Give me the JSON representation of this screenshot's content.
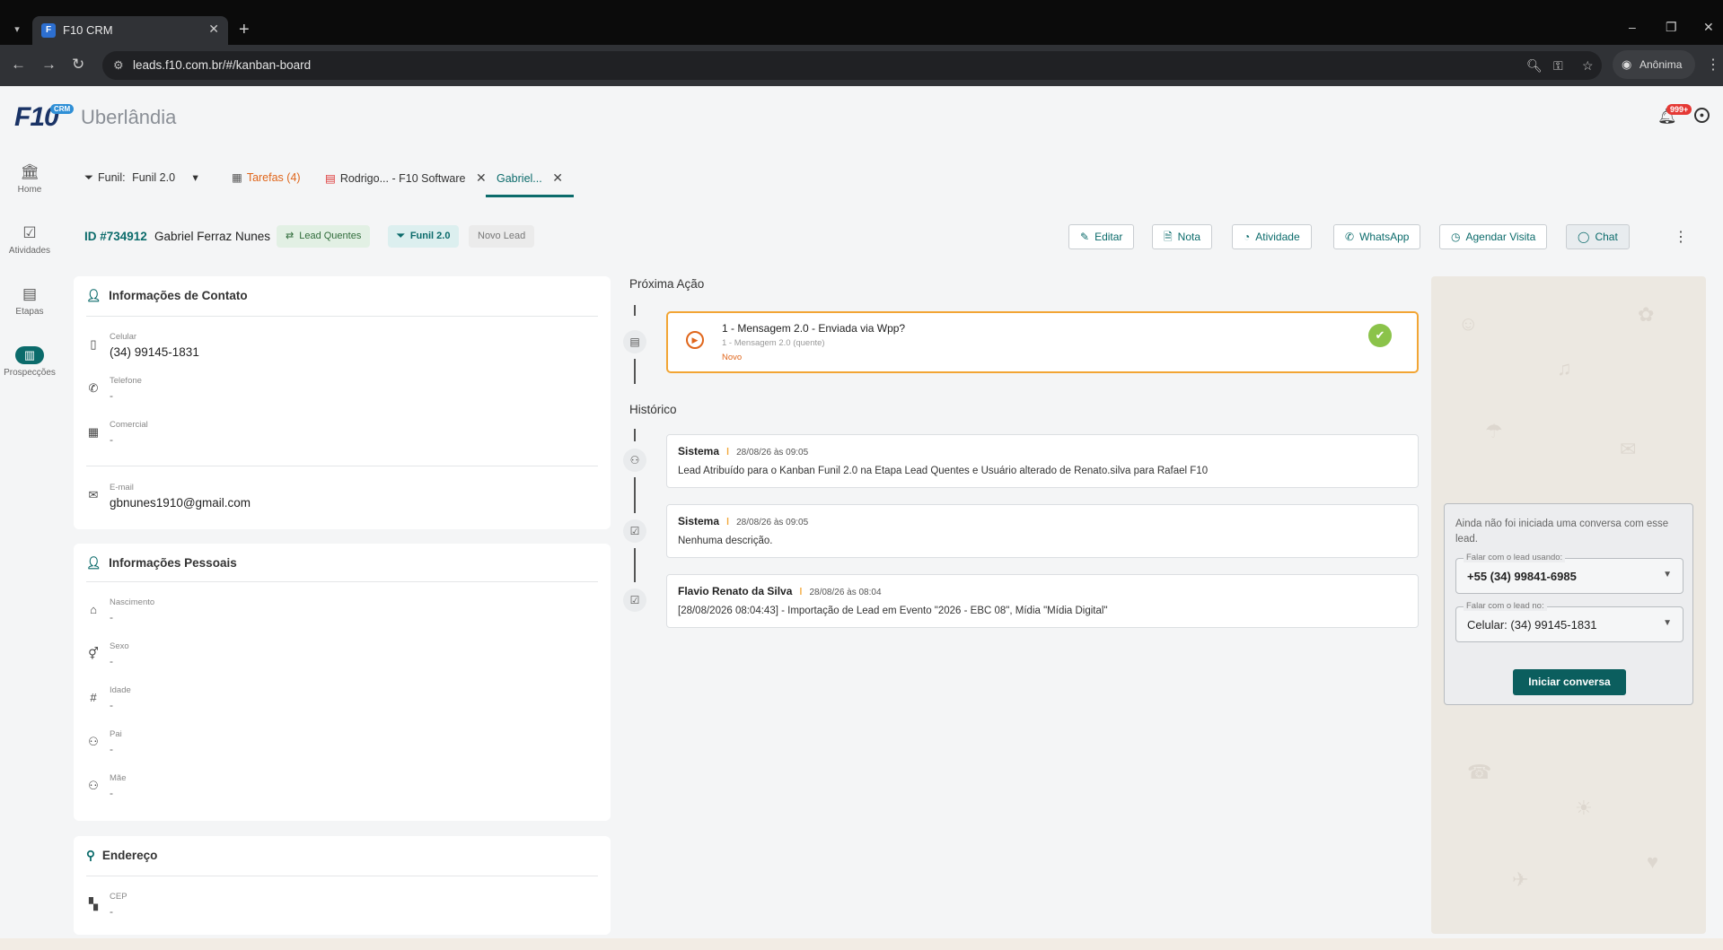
{
  "browser": {
    "tab_title": "F10 CRM",
    "url": "leads.f10.com.br/#/kanban-board",
    "profile_label": "Anônima"
  },
  "app": {
    "logo": "F10",
    "logo_badge": "CRM",
    "city": "Uberlândia",
    "notifications": "999+"
  },
  "sidenav": [
    {
      "label": "Home",
      "icon": "bank-icon"
    },
    {
      "label": "Atividades",
      "icon": "checklist-icon"
    },
    {
      "label": "Etapas",
      "icon": "board-icon"
    },
    {
      "label": "Prospecções",
      "icon": "columns-icon"
    }
  ],
  "tabs": {
    "funnel_prefix": "Funil:",
    "funnel_value": "Funil 2.0",
    "tasks": "Tarefas (4)",
    "rodrigo": "Rodrigo... - F10 Software",
    "gabriel": "Gabriel..."
  },
  "lead": {
    "id": "ID #734912",
    "name": "Gabriel Ferraz Nunes",
    "chips": {
      "stage": "Lead Quentes",
      "funnel": "Funil 2.0",
      "status": "Novo Lead"
    },
    "actions": {
      "edit": "Editar",
      "note": "Nota",
      "activity": "Atividade",
      "whatsapp": "WhatsApp",
      "visit": "Agendar Visita",
      "chat": "Chat"
    }
  },
  "contact": {
    "title": "Informações de Contato",
    "mobile_label": "Celular",
    "mobile_value": "(34) 99145-1831",
    "phone_label": "Telefone",
    "phone_value": "-",
    "commercial_label": "Comercial",
    "commercial_value": "-",
    "email_label": "E-mail",
    "email_value": "gbnunes1910@gmail.com"
  },
  "personal": {
    "title": "Informações Pessoais",
    "birth_label": "Nascimento",
    "birth_value": "-",
    "sex_label": "Sexo",
    "sex_value": "-",
    "age_label": "Idade",
    "age_value": "-",
    "father_label": "Pai",
    "father_value": "-",
    "mother_label": "Mãe",
    "mother_value": "-"
  },
  "address": {
    "title": "Endereço",
    "cep_label": "CEP",
    "cep_value": "-"
  },
  "next_action": {
    "title": "Próxima Ação",
    "item_title": "1 - Mensagem 2.0 - Enviada via Wpp?",
    "item_sub": "1 - Mensagem 2.0 (quente)",
    "item_status": "Novo"
  },
  "history": {
    "title": "Histórico",
    "items": [
      {
        "author": "Sistema",
        "time": "28/08/26 às 09:05",
        "text": "Lead Atribuído para o Kanban Funil 2.0 na Etapa Lead Quentes e Usuário alterado de Renato.silva para Rafael F10"
      },
      {
        "author": "Sistema",
        "time": "28/08/26 às 09:05",
        "text": "Nenhuma descrição."
      },
      {
        "author": "Flavio Renato da Silva",
        "time": "28/08/26 às 08:04",
        "text": "[28/08/2026 08:04:43] - Importação de Lead em Evento \"2026 - EBC 08\", Mídia \"Mídia Digital\""
      }
    ]
  },
  "chat": {
    "message": "Ainda não foi iniciada uma conversa com esse lead.",
    "from_label": "Falar com o lead usando:",
    "from_value": "+55 (34) 99841-6985",
    "to_label": "Falar com o lead no:",
    "to_value": "Celular: (34) 99145-1831",
    "start_button": "Iniciar conversa"
  },
  "colors": {
    "primary": "#0b6b6b",
    "accent_orange": "#e0661b",
    "highlight_border": "#f2a534",
    "success": "#8bc34a"
  }
}
